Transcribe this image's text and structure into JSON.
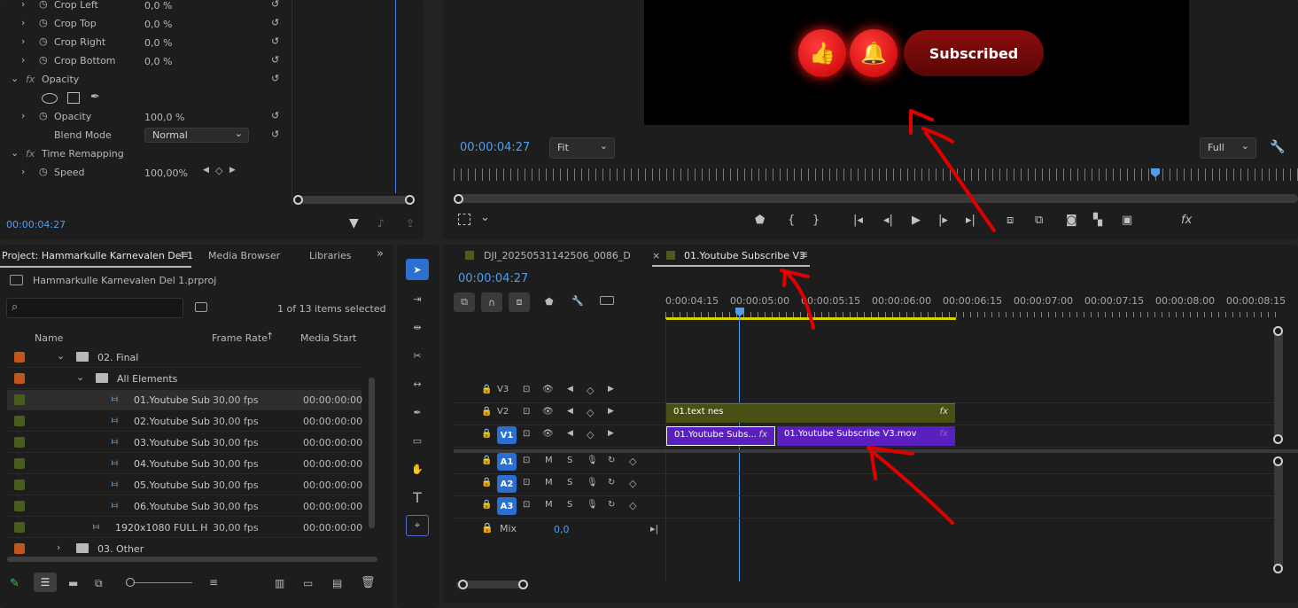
{
  "effect_controls": {
    "crop_left": {
      "label": "Crop Left",
      "value": "0,0 %"
    },
    "crop_top": {
      "label": "Crop Top",
      "value": "0,0 %"
    },
    "crop_right": {
      "label": "Crop Right",
      "value": "0,0 %"
    },
    "crop_bottom": {
      "label": "Crop Bottom",
      "value": "0,0 %"
    },
    "opacity_group": {
      "label": "Opacity",
      "fx": "fx"
    },
    "opacity": {
      "label": "Opacity",
      "value": "100,0 %"
    },
    "blend_mode": {
      "label": "Blend Mode",
      "value": "Normal"
    },
    "time_remap_group": {
      "label": "Time Remapping",
      "fx": "fx"
    },
    "speed": {
      "label": "Speed",
      "value": "100,00%"
    },
    "timecode": "00:00:04:27"
  },
  "program_monitor": {
    "timecode": "00:00:04:27",
    "fit": "Fit",
    "quality": "Full",
    "subscribed_label": "Subscribed"
  },
  "project": {
    "tabs": [
      "Project: Hammarkulle Karnevalen Del 1",
      "Media Browser",
      "Libraries"
    ],
    "file": "Hammarkulle Karnevalen Del 1.prproj",
    "selection_status": "1 of 13 items selected",
    "columns": [
      "Name",
      "Frame Rate",
      "Media Start"
    ],
    "items": [
      {
        "name": "02. Final",
        "rate": "",
        "start": "",
        "type": "folder",
        "color": "#c4561c"
      },
      {
        "name": "All Elements",
        "rate": "",
        "start": "",
        "type": "folder",
        "color": "#c4561c"
      },
      {
        "name": "01.Youtube Sub",
        "rate": "30,00 fps",
        "start": "00:00:00:00",
        "type": "seq",
        "color": "#4a5d1c"
      },
      {
        "name": "02.Youtube Sub",
        "rate": "30,00 fps",
        "start": "00:00:00:00",
        "type": "seq",
        "color": "#4a5d1c"
      },
      {
        "name": "03.Youtube Sub",
        "rate": "30,00 fps",
        "start": "00:00:00:00",
        "type": "seq",
        "color": "#4a5d1c"
      },
      {
        "name": "04.Youtube Sub",
        "rate": "30,00 fps",
        "start": "00:00:00:00",
        "type": "seq",
        "color": "#4a5d1c"
      },
      {
        "name": "05.Youtube Sub",
        "rate": "30,00 fps",
        "start": "00:00:00:00",
        "type": "seq",
        "color": "#4a5d1c"
      },
      {
        "name": "06.Youtube Sub",
        "rate": "30,00 fps",
        "start": "00:00:00:00",
        "type": "seq",
        "color": "#4a5d1c"
      },
      {
        "name": "1920x1080 FULL H",
        "rate": "30,00 fps",
        "start": "00:00:00:00",
        "type": "seq",
        "color": "#4a5d1c"
      },
      {
        "name": "03. Other",
        "rate": "",
        "start": "",
        "type": "folder",
        "color": "#c4561c"
      }
    ]
  },
  "timeline": {
    "tabs": [
      "DJI_20250531142506_0086_D",
      "01.Youtube Subscribe V3"
    ],
    "close_glyph": "×",
    "timecode": "00:00:04:27",
    "ruler": [
      "0:00:04:15",
      "00:00:05:00",
      "00:00:05:15",
      "00:00:06:00",
      "00:00:06:15",
      "00:00:07:00",
      "00:00:07:15",
      "00:00:08:00",
      "00:00:08:15"
    ],
    "video_tracks": [
      "V3",
      "V2",
      "V1"
    ],
    "audio_tracks": [
      "A1",
      "A2",
      "A3"
    ],
    "mix_label": "Mix",
    "mix_value": "0,0",
    "mute": "M",
    "solo": "S",
    "clips": {
      "v2": "01.text nes",
      "v1a": "01.Youtube Subs...",
      "v1b": "01.Youtube Subscribe V3.mov",
      "fx": "fx"
    }
  },
  "colors": {
    "accent": "#4f9ff0",
    "annotation": "#e00000",
    "clip_purple": "#5a1fbf",
    "clip_olive": "#4a5013"
  }
}
